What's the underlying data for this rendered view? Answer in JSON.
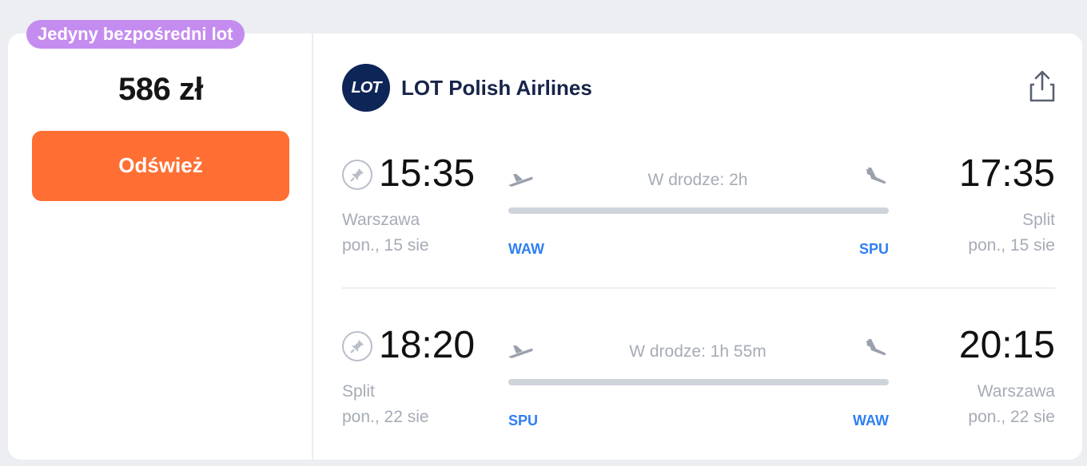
{
  "badge": "Jedyny bezpośredni lot",
  "price": "586 zł",
  "refresh_label": "Odśwież",
  "airline": {
    "logo_text": "LOT",
    "name": "LOT Polish Airlines"
  },
  "legs": [
    {
      "dep_time": "15:35",
      "arr_time": "17:35",
      "dep_city": "Warszawa",
      "arr_city": "Split",
      "dep_date": "pon., 15 sie",
      "arr_date": "pon., 15 sie",
      "duration": "W drodze: 2h",
      "dep_code": "WAW",
      "arr_code": "SPU"
    },
    {
      "dep_time": "18:20",
      "arr_time": "20:15",
      "dep_city": "Split",
      "arr_city": "Warszawa",
      "dep_date": "pon., 22 sie",
      "arr_date": "pon., 22 sie",
      "duration": "W drodze: 1h 55m",
      "dep_code": "SPU",
      "arr_code": "WAW"
    }
  ],
  "colors": {
    "badge": "#c58cf0",
    "refresh_button": "#ff6f33",
    "airport_code": "#2e7ff2",
    "logo_bg": "#0e2557"
  },
  "icons": {
    "share": "share-icon",
    "pin": "pin-icon",
    "takeoff": "plane-takeoff-icon",
    "landing": "plane-landing-icon"
  }
}
